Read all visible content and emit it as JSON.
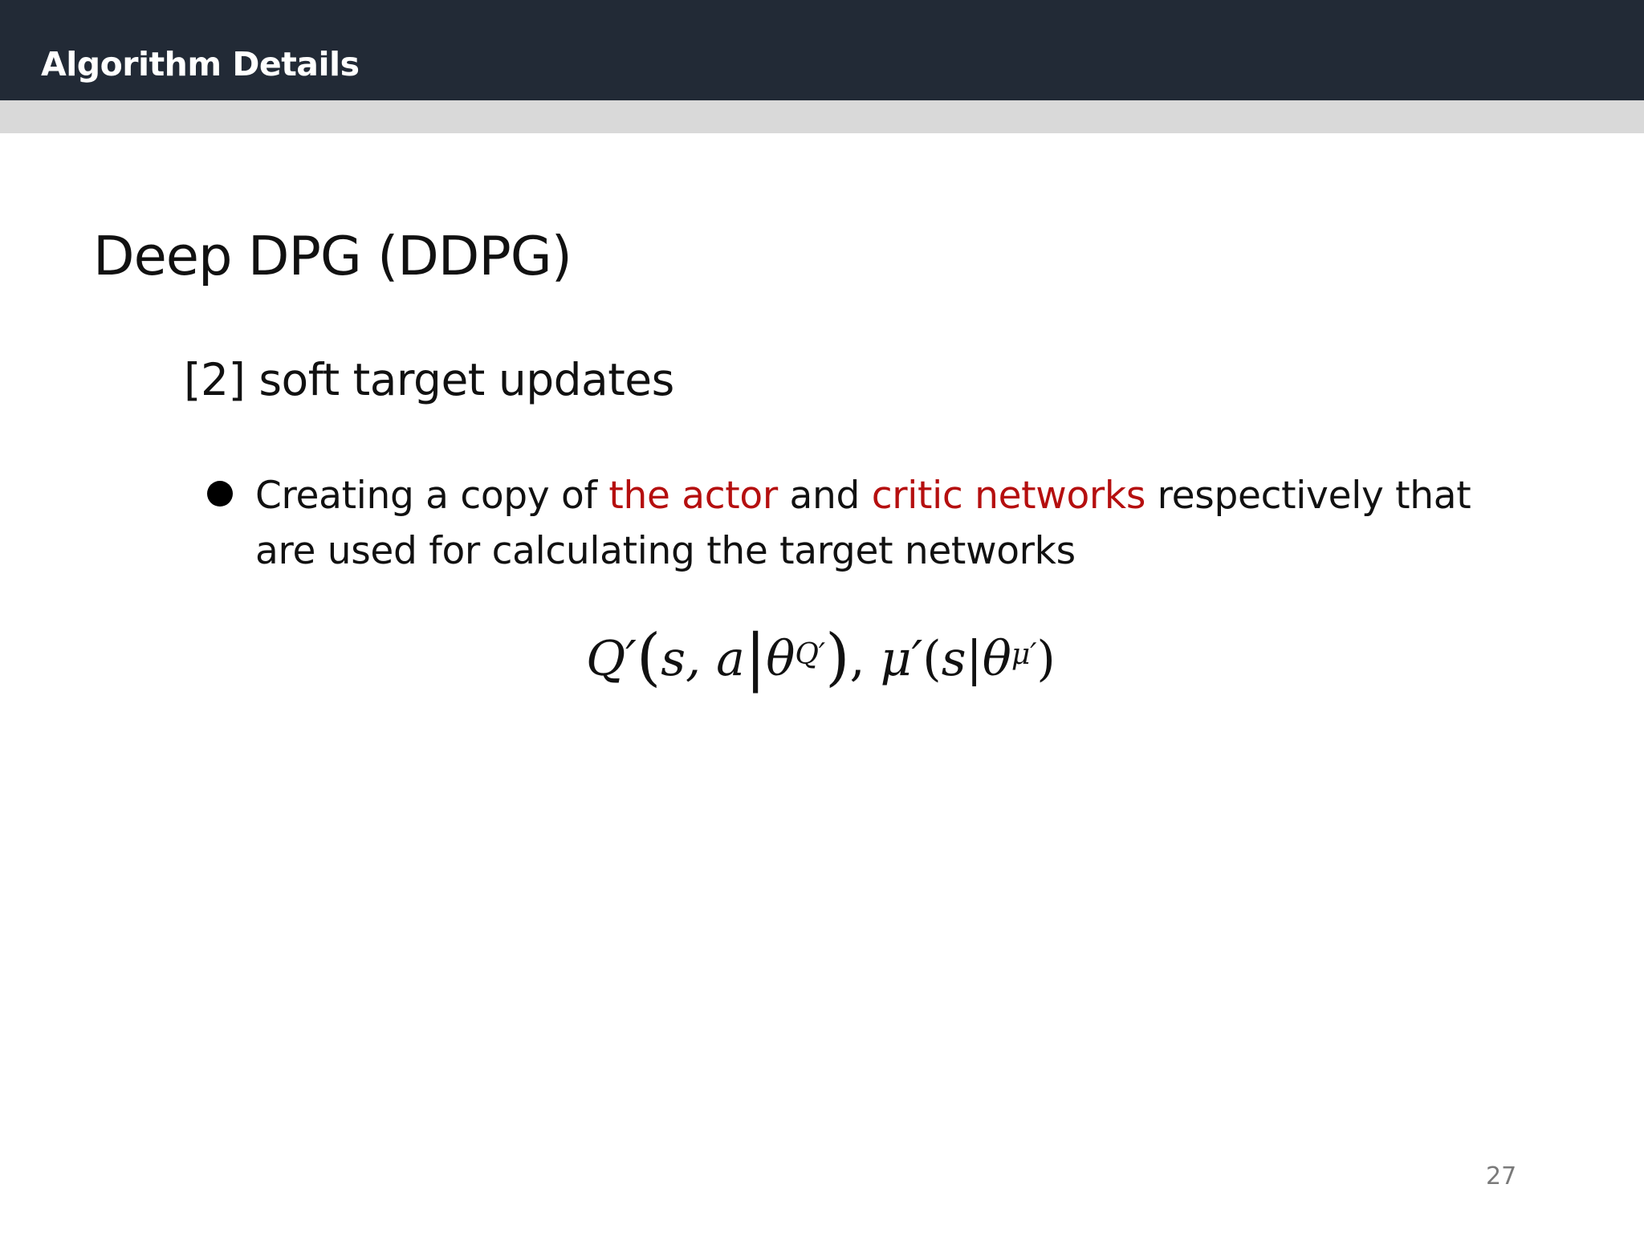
{
  "header": {
    "title": "Algorithm Details"
  },
  "slide": {
    "title": "Deep DPG (DDPG)",
    "section_heading": "[2] soft target updates",
    "bullet": {
      "part1": "Creating a copy of ",
      "highlight1": "the actor",
      "part2": " and ",
      "highlight2": "critic networks",
      "part3": " respectively that are used for calculating the target networks"
    },
    "formula": {
      "q_prime": "Q′",
      "open_paren": "(",
      "args": "s, a",
      "bar": "|",
      "theta1": "θ",
      "sup1": "Q′",
      "close_paren": ")",
      "comma": ",",
      "mu_prime": "μ′",
      "open_paren2": "(",
      "s2": "s",
      "bar2": "|",
      "theta2": "θ",
      "sup2": "μ′",
      "close_paren2": ")"
    },
    "page_number": "27"
  },
  "colors": {
    "header_bg": "#222a36",
    "stripe": "#d9d9d9",
    "accent": "#b50f0f"
  }
}
